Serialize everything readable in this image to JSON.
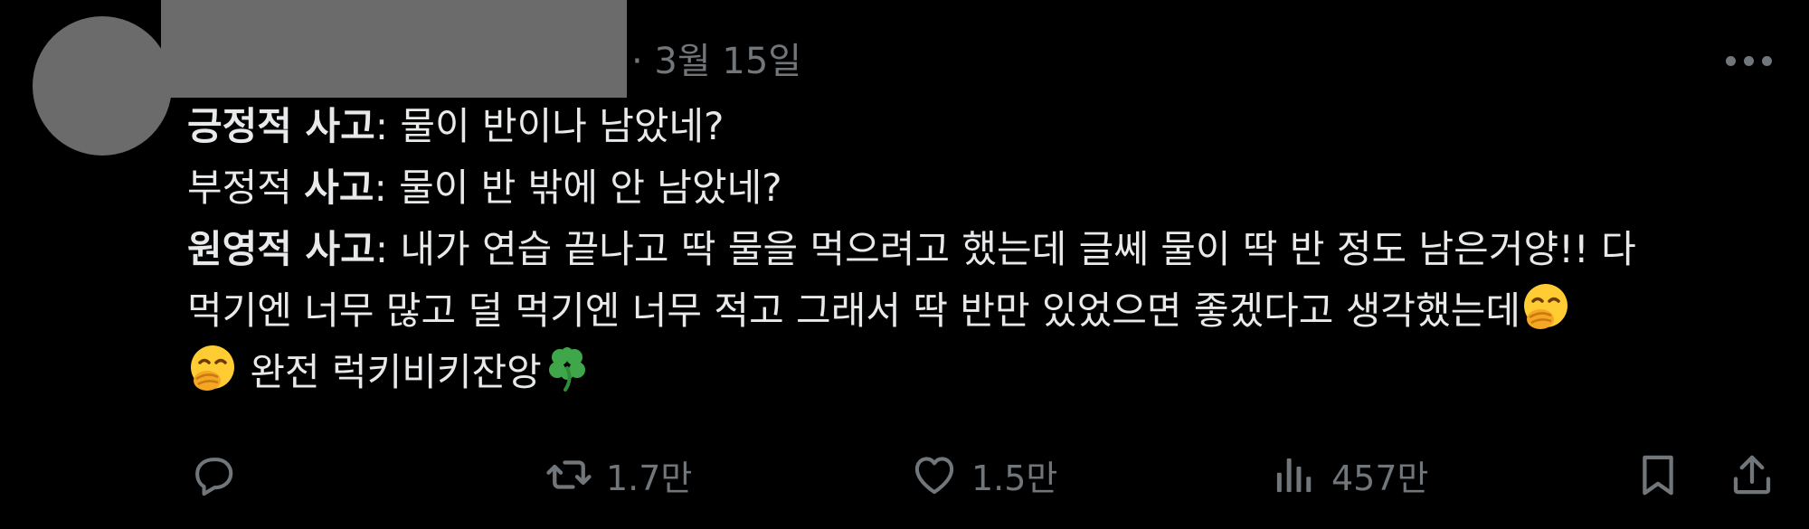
{
  "tweet": {
    "date": "· 3월 15일",
    "lines": [
      {
        "label": "긍정적 사고",
        "label_prefix": "",
        "text": ": 물이 반이나 남았네?"
      },
      {
        "label": "사고",
        "label_prefix": "부정적 ",
        "text": ": 물이 반 밖에 안 남았네?"
      },
      {
        "label": "원영적 사고",
        "label_prefix": "",
        "text": ": 내가 연습 끝나고 딱 물을 먹으려고 했는데 글쎄 물이 딱 반 정도 남은거양!! 다"
      }
    ],
    "line4": "먹기엔 너무 많고 덜 먹기엔 너무 적고 그래서 딱 반만 있었으면 좋겠다고 생각했는데",
    "line5": " 완전 럭키비키잔앙",
    "emojis": [
      "hand-over-mouth-emoji",
      "hand-over-mouth-emoji",
      "four-leaf-clover-emoji"
    ]
  },
  "actions": {
    "reply_icon": "reply-icon",
    "retweet_icon": "retweet-icon",
    "retweet_count": "1.7만",
    "like_icon": "heart-icon",
    "like_count": "1.5만",
    "views_icon": "views-icon",
    "views_count": "457만",
    "bookmark_icon": "bookmark-icon",
    "share_icon": "share-icon"
  },
  "colors": {
    "background": "#000000",
    "text": "#e7e9ea",
    "secondary": "#71767b",
    "redaction": "#6b6b6b"
  }
}
